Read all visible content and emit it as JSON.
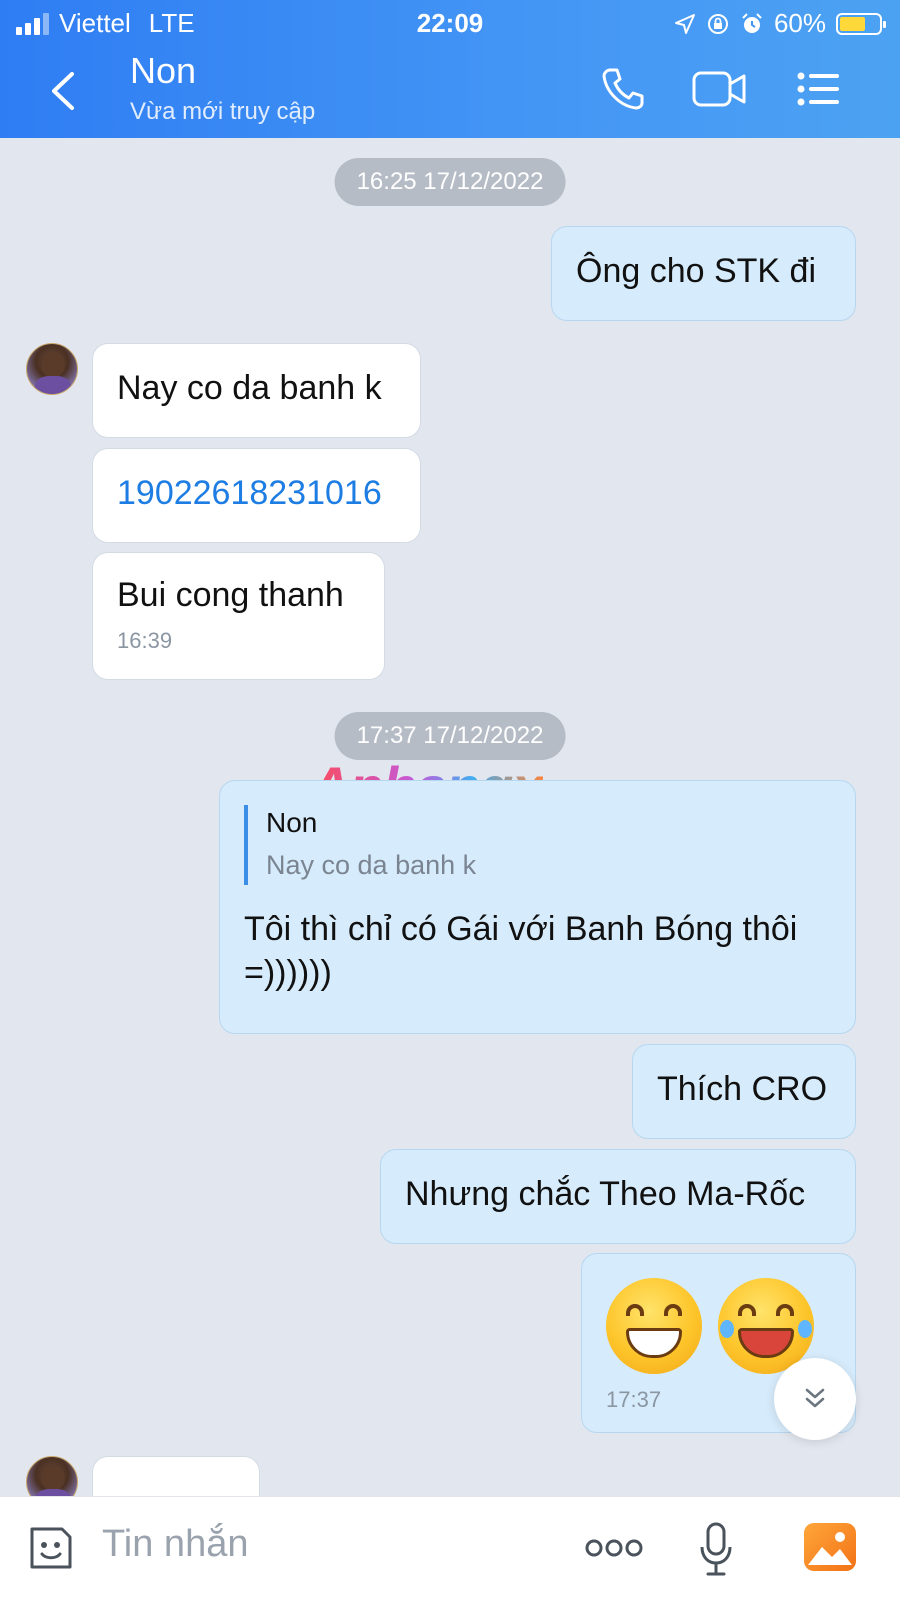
{
  "status_bar": {
    "carrier": "Viettel",
    "network": "LTE",
    "time": "22:09",
    "battery": "60%"
  },
  "header": {
    "contact_name": "Non",
    "contact_status": "Vừa mới truy cập",
    "icons": [
      "back-icon",
      "phone-icon",
      "video-call-icon",
      "menu-icon"
    ]
  },
  "chat": {
    "time_separator_1": "16:25 17/12/2022",
    "msg_out_1": "Ông cho STK đi",
    "msg_in_1": "Nay co da banh k",
    "msg_in_2": "19022618231016",
    "msg_in_3": "Bui cong thanh",
    "msg_in_3_time": "16:39",
    "time_separator_2": "17:37 17/12/2022",
    "reply_quote_name": "Non",
    "reply_quote_text": "Nay co da banh k",
    "msg_out_2": "Tôi thì chỉ có Gái với Banh Bóng thôi =))))))",
    "msg_out_3": "Thích CRO",
    "msg_out_4": "Nhưng chắc Theo Ma-Rốc",
    "msg_out_5_emojis": [
      "grinning-face",
      "face-with-tears-of-joy"
    ],
    "msg_out_5_time": "17:37",
    "watermark": "Aphangx"
  },
  "input_bar": {
    "placeholder": "Tin nhắn",
    "icons": [
      "sticker-icon",
      "more-icon",
      "microphone-icon",
      "image-icon"
    ]
  },
  "colors": {
    "header_start": "#2f7df3",
    "header_end": "#4ca2f2",
    "chat_background": "#e2e7ef",
    "outgoing_bubble": "#d6ebfb",
    "incoming_bubble": "#ffffff",
    "link": "#1d7de3"
  }
}
